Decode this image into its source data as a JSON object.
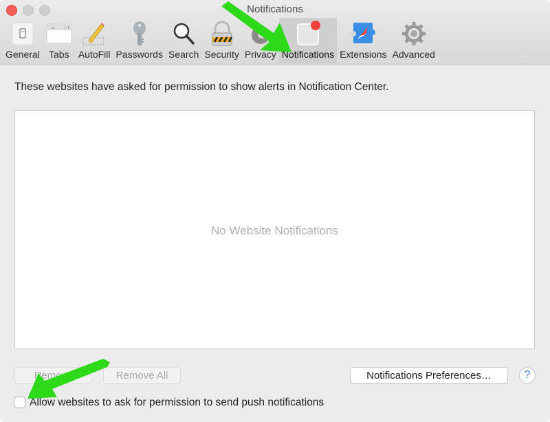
{
  "window": {
    "title": "Notifications",
    "traffic_lights": [
      "close",
      "minimize",
      "zoom"
    ]
  },
  "toolbar": {
    "active": "Notifications",
    "items": [
      {
        "label": "General",
        "icon": "general-switch-icon"
      },
      {
        "label": "Tabs",
        "icon": "tabs-icon"
      },
      {
        "label": "AutoFill",
        "icon": "pencil-icon"
      },
      {
        "label": "Passwords",
        "icon": "key-icon"
      },
      {
        "label": "Search",
        "icon": "magnifier-icon"
      },
      {
        "label": "Security",
        "icon": "padlock-icon"
      },
      {
        "label": "Privacy",
        "icon": "privacy-hand-icon"
      },
      {
        "label": "Notifications",
        "icon": "notification-badge-icon"
      },
      {
        "label": "Extensions",
        "icon": "puzzle-compass-icon"
      },
      {
        "label": "Advanced",
        "icon": "gear-icon"
      }
    ]
  },
  "content": {
    "intro": "These websites have asked for permission to show alerts in Notification Center.",
    "list_empty_message": "No Website Notifications",
    "buttons": {
      "remove": "Remove",
      "remove_all": "Remove All",
      "preferences": "Notifications Preferences…",
      "help": "?"
    },
    "allow_push_checkbox": {
      "label": "Allow websites to ask for permission to send push notifications",
      "checked": false
    }
  },
  "colors": {
    "annotation_arrow": "#2ed91a",
    "notification_dot": "#f0403a",
    "help_accent": "#3d84e8"
  }
}
